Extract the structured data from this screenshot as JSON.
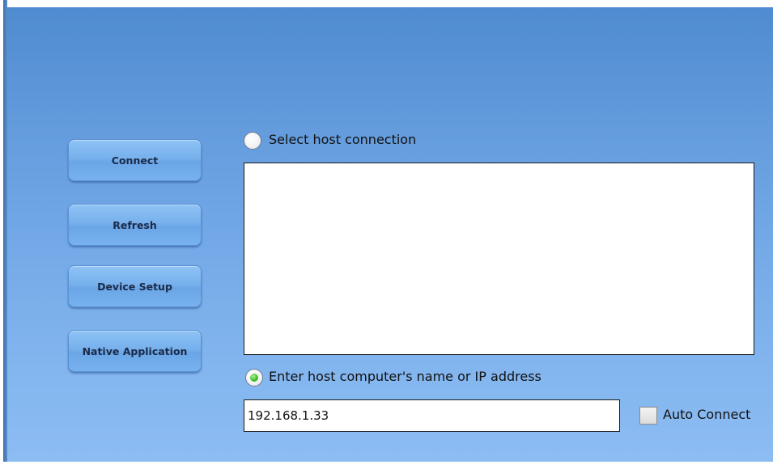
{
  "sidebar": {
    "buttons": [
      {
        "label": "Connect"
      },
      {
        "label": "Refresh"
      },
      {
        "label": "Device Setup"
      },
      {
        "label": "Native Application"
      }
    ]
  },
  "host_selection": {
    "select_option_label": "Select host connection",
    "select_option_selected": false,
    "host_list": [],
    "enter_option_label": "Enter host computer's name or IP address",
    "enter_option_selected": true,
    "host_address_value": "192.168.1.33"
  },
  "auto_connect": {
    "label": "Auto Connect",
    "checked": false
  },
  "colors": {
    "panel_top": "#4f8bd0",
    "panel_bottom": "#8cbcf2",
    "radio_selected": "#3fbf2b"
  }
}
